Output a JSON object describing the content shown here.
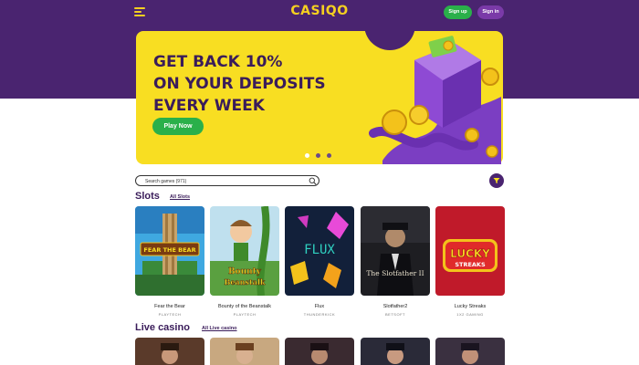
{
  "header": {
    "logo": "CASIQO",
    "signup_label": "Sign up",
    "signin_label": "Sign in"
  },
  "banner": {
    "line1": "GET BACK 10%",
    "line2": "ON YOUR DEPOSITS",
    "line3": "EVERY WEEK",
    "cta_label": "Play Now",
    "slide_count": 3,
    "active_slide": 1
  },
  "search": {
    "placeholder": "Search games (971)"
  },
  "slots": {
    "title": "Slots",
    "link": "All Slots",
    "games": [
      {
        "name": "Fear the Bear",
        "provider": "PLAYTECH"
      },
      {
        "name": "Bounty of the Beanstalk",
        "provider": "PLAYTECH"
      },
      {
        "name": "Flux",
        "provider": "THUNDERKICK"
      },
      {
        "name": "Slotfather2",
        "provider": "BETSOFT"
      },
      {
        "name": "Lucky Streaks",
        "provider": "1X2 GAMING"
      }
    ]
  },
  "live": {
    "title": "Live casino",
    "link": "All Live casino"
  },
  "colors": {
    "brand_purple": "#4a2470",
    "accent_yellow": "#f8de22",
    "button_green": "#2ab04a",
    "signin_purple": "#7a3aa8"
  },
  "icons": {
    "menu": "hamburger-menu-icon",
    "search": "search-icon",
    "filter": "filter-icon"
  }
}
